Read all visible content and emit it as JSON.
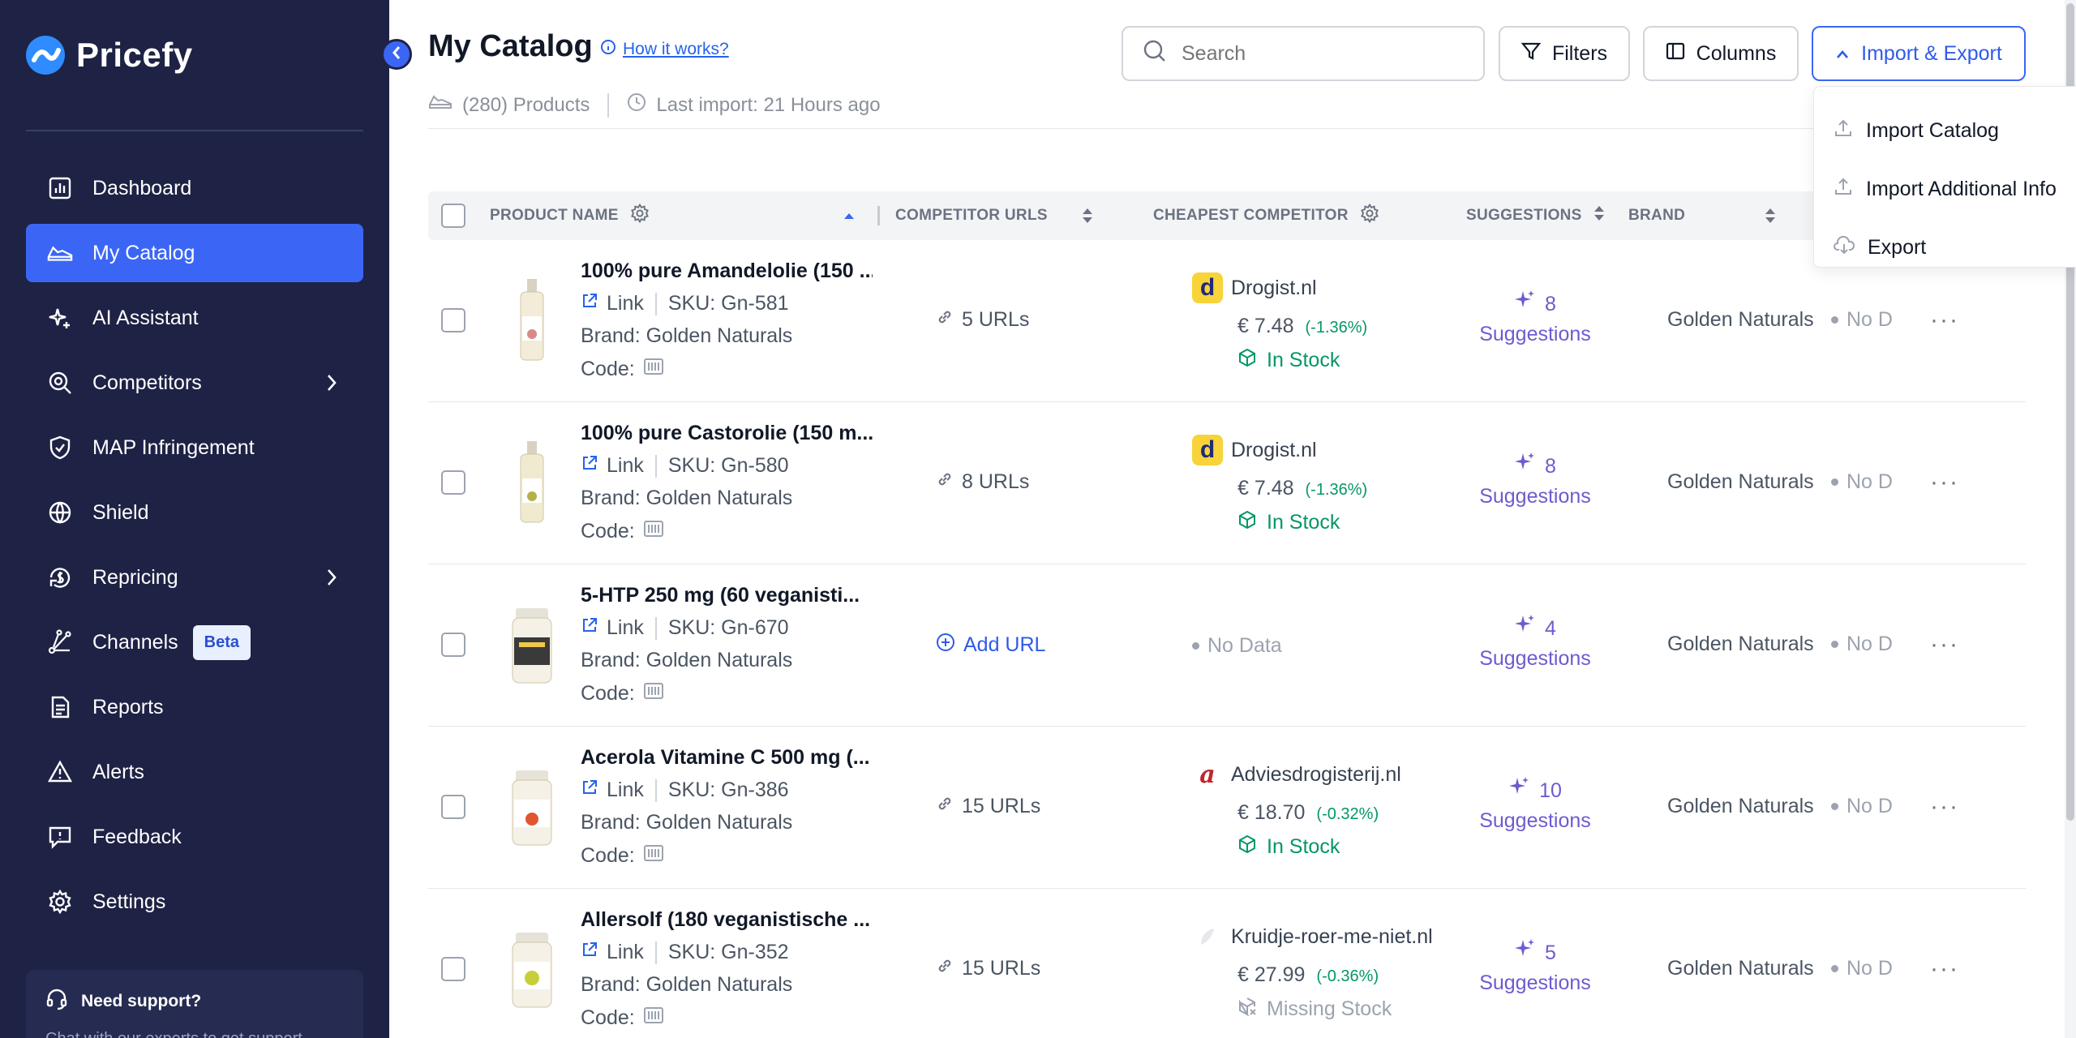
{
  "app": {
    "name": "Pricefy",
    "brand_color": "#2f8cff"
  },
  "sidebar": {
    "items": [
      {
        "label": "Dashboard",
        "icon": "dashboard-icon"
      },
      {
        "label": "My Catalog",
        "icon": "catalog-icon",
        "active": true
      },
      {
        "label": "AI Assistant",
        "icon": "ai-sparkle-icon"
      },
      {
        "label": "Competitors",
        "icon": "competitors-icon",
        "has_submenu": true
      },
      {
        "label": "MAP Infringement",
        "icon": "shield-check-icon"
      },
      {
        "label": "Shield",
        "icon": "globe-icon"
      },
      {
        "label": "Repricing",
        "icon": "repricing-icon",
        "has_submenu": true
      },
      {
        "label": "Channels",
        "icon": "channels-icon",
        "badge": "Beta"
      },
      {
        "label": "Reports",
        "icon": "reports-icon"
      },
      {
        "label": "Alerts",
        "icon": "alert-icon"
      },
      {
        "label": "Feedback",
        "icon": "feedback-icon"
      },
      {
        "label": "Settings",
        "icon": "settings-icon"
      }
    ],
    "support": {
      "title": "Need support?",
      "subtitle": "Chat with our experts to get support."
    },
    "active_color": "#3b66f5",
    "bg_color": "#1e2245"
  },
  "header": {
    "title": "My Catalog",
    "how_it_works": "How it works?",
    "products_count": "(280) Products",
    "last_import": "Last import: 21 Hours ago",
    "search_placeholder": "Search",
    "filters_label": "Filters",
    "columns_label": "Columns",
    "import_export_label": "Import & Export"
  },
  "import_menu": {
    "items": [
      "Import Catalog",
      "Import Additional Info",
      "Export"
    ]
  },
  "table": {
    "headers": {
      "product_name": "PRODUCT NAME",
      "competitor_urls": "COMPETITOR URLS",
      "cheapest_competitor": "CHEAPEST COMPETITOR",
      "suggestions": "SUGGESTIONS",
      "brand": "BRAND"
    },
    "rows": [
      {
        "name": "100% pure Amandelolie (150 ...",
        "link": "Link",
        "sku": "SKU: Gn-581",
        "brand_line": "Brand: Golden Naturals",
        "code": "Code:",
        "urls": "5 URLs",
        "competitor": "Drogist.nl",
        "price": "€ 7.48",
        "delta": "(-1.36%)",
        "stock": "In Stock",
        "sugg_count": "8",
        "sugg_label": "Suggestions",
        "brand": "Golden Naturals",
        "last": "No D"
      },
      {
        "name": "100% pure Castorolie (150 m...",
        "link": "Link",
        "sku": "SKU: Gn-580",
        "brand_line": "Brand: Golden Naturals",
        "code": "Code:",
        "urls": "8 URLs",
        "competitor": "Drogist.nl",
        "price": "€ 7.48",
        "delta": "(-1.36%)",
        "stock": "In Stock",
        "sugg_count": "8",
        "sugg_label": "Suggestions",
        "brand": "Golden Naturals",
        "last": "No D"
      },
      {
        "name": "5-HTP 250 mg (60 veganisti...",
        "link": "Link",
        "sku": "SKU: Gn-670",
        "brand_line": "Brand: Golden Naturals",
        "code": "Code:",
        "add_url": "Add URL",
        "no_data": "No Data",
        "sugg_count": "4",
        "sugg_label": "Suggestions",
        "brand": "Golden Naturals",
        "last": "No D"
      },
      {
        "name": "Acerola Vitamine C 500 mg (...",
        "link": "Link",
        "sku": "SKU: Gn-386",
        "brand_line": "Brand: Golden Naturals",
        "code": "Code:",
        "urls": "15 URLs",
        "competitor": "Adviesdrogisterij.nl",
        "price": "€ 18.70",
        "delta": "(-0.32%)",
        "stock": "In Stock",
        "sugg_count": "10",
        "sugg_label": "Suggestions",
        "brand": "Golden Naturals",
        "last": "No D"
      },
      {
        "name": "Allersolf (180 veganistische ...",
        "link": "Link",
        "sku": "SKU: Gn-352",
        "brand_line": "Brand: Golden Naturals",
        "code": "Code:",
        "urls": "15 URLs",
        "competitor": "Kruidje-roer-me-niet.nl",
        "price": "€ 27.99",
        "delta": "(-0.36%)",
        "stock": "Missing Stock",
        "sugg_count": "5",
        "sugg_label": "Suggestions",
        "brand": "Golden Naturals",
        "last": "No D"
      }
    ]
  }
}
